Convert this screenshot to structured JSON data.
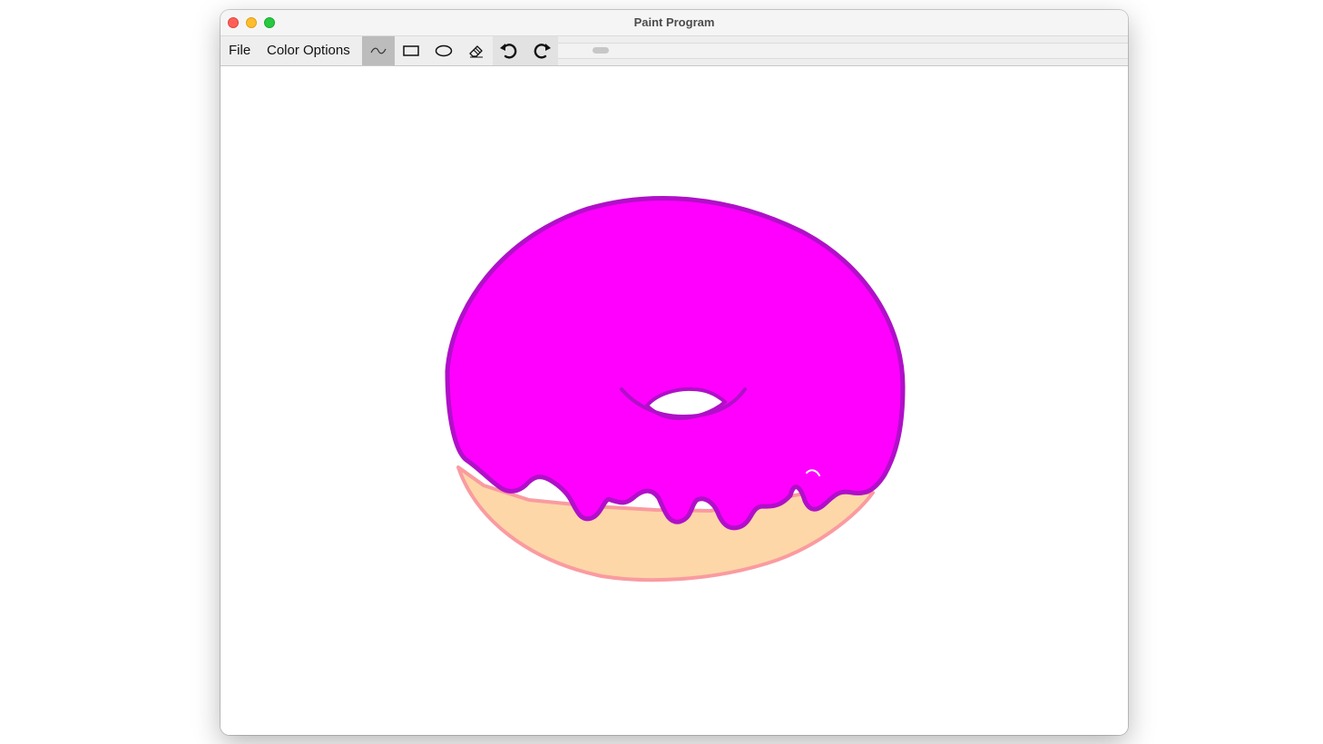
{
  "window": {
    "title": "Paint Program"
  },
  "menu": {
    "file": "File",
    "color_options": "Color Options"
  },
  "toolbar": {
    "selected_tool": "freehand",
    "tools": [
      {
        "id": "freehand",
        "icon": "freehand-line-icon",
        "selected": true
      },
      {
        "id": "rectangle",
        "icon": "rectangle-icon",
        "selected": false
      },
      {
        "id": "oval",
        "icon": "oval-icon",
        "selected": false
      },
      {
        "id": "eraser",
        "icon": "eraser-icon",
        "selected": false
      },
      {
        "id": "undo",
        "icon": "undo-icon",
        "selected": false
      },
      {
        "id": "redo",
        "icon": "redo-icon",
        "selected": false
      }
    ],
    "brush_size_slider": {
      "value_fraction": 0.06
    }
  },
  "drawing": {
    "subject": "donut",
    "colors": {
      "icing": "#ff00ff",
      "icing_outline": "#b010c8",
      "dough": "#fdd7a8",
      "dough_outline": "#fa9ba0",
      "hole": "#ffffff"
    }
  },
  "colors": {
    "selected_tool_bg": "#bdbcbd",
    "toolbar_bg": "#efeeef",
    "titlebar_bg": "#f6f5f6"
  }
}
